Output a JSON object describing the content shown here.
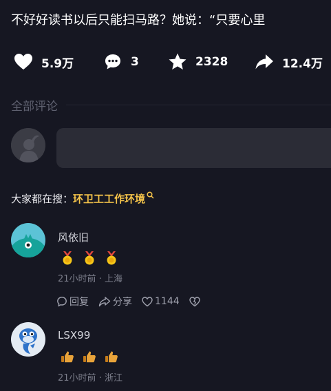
{
  "video": {
    "title": "不好好读书以后只能扫马路？她说：“只要心里"
  },
  "actions": [
    {
      "icon": "heart-icon",
      "count": "5.9万"
    },
    {
      "icon": "comment-bubble-icon",
      "count": "3"
    },
    {
      "icon": "star-icon",
      "count": "2328"
    },
    {
      "icon": "share-arrow-icon",
      "count": "12.4万"
    }
  ],
  "comments_section": {
    "heading": "全部评论",
    "input_placeholder": ""
  },
  "search_hint": {
    "prefix": "大家都在搜：",
    "term": "环卫工工作环境"
  },
  "comments": [
    {
      "username": "风依旧",
      "emoji": [
        "medal-emoji",
        "medal-emoji",
        "medal-emoji"
      ],
      "meta": "21小时前 · 上海",
      "reply_label": "回复",
      "share_label": "分享",
      "likes": "1144"
    },
    {
      "username": "LSX99",
      "emoji": [
        "thumbs-up-emoji",
        "thumbs-up-emoji",
        "thumbs-up-emoji"
      ],
      "meta": "21小时前 · 浙江"
    }
  ],
  "colors": {
    "background": "#161722",
    "accent_search_term": "#f4c34a",
    "input_bg": "#2b2c36"
  }
}
